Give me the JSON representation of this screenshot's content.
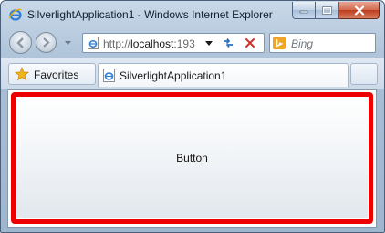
{
  "window": {
    "title": "SilverlightApplication1 - Windows Internet Explorer",
    "icon": "ie-logo-icon",
    "caption_buttons": [
      "minimize-icon",
      "maximize-icon",
      "close-icon"
    ]
  },
  "navigation": {
    "back_icon": "back-arrow-icon",
    "forward_icon": "forward-arrow-icon",
    "address": {
      "prefix": "http://",
      "host": "localhost",
      "suffix": ":193"
    },
    "refresh_icon": "refresh-icon",
    "stop_icon": "stop-icon",
    "search_placeholder": "Bing",
    "search_provider_icon": "bing-icon"
  },
  "tabs": {
    "favorites_label": "Favorites",
    "active_tab_label": "SilverlightApplication1"
  },
  "content": {
    "button_label": "Button",
    "button_border_color": "#ec0000"
  }
}
